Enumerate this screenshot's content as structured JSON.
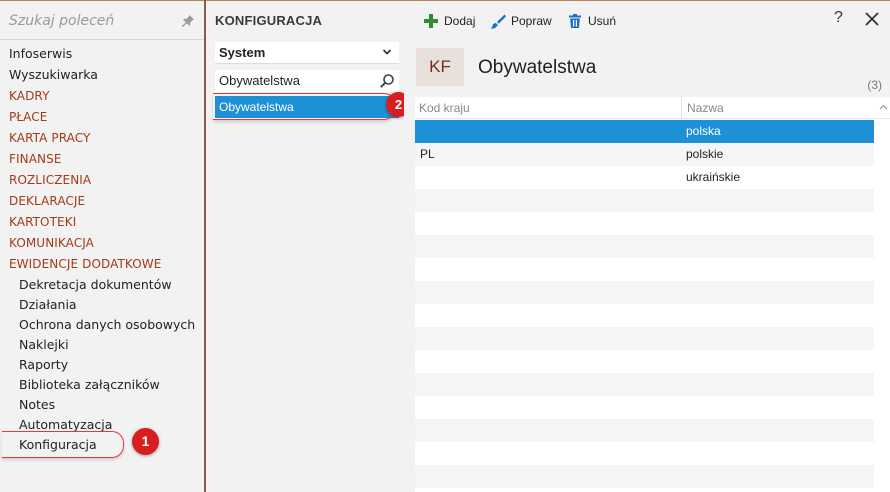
{
  "nav": {
    "search_placeholder": "Szukaj poleceń",
    "items": [
      {
        "label": "Infoserwis",
        "kind": "plain"
      },
      {
        "label": "Wyszukiwarka",
        "kind": "plain"
      },
      {
        "label": "KADRY",
        "kind": "cat"
      },
      {
        "label": "PŁACE",
        "kind": "cat"
      },
      {
        "label": "KARTA PRACY",
        "kind": "cat"
      },
      {
        "label": "FINANSE",
        "kind": "cat"
      },
      {
        "label": "ROZLICZENIA",
        "kind": "cat"
      },
      {
        "label": "DEKLARACJE",
        "kind": "cat"
      },
      {
        "label": "KARTOTEKI",
        "kind": "cat"
      },
      {
        "label": "KOMUNIKACJA",
        "kind": "cat"
      },
      {
        "label": "EWIDENCJE DODATKOWE",
        "kind": "cat"
      },
      {
        "label": "Dekretacja dokumentów",
        "kind": "sub"
      },
      {
        "label": "Działania",
        "kind": "sub"
      },
      {
        "label": "Ochrona danych osobowych",
        "kind": "sub"
      },
      {
        "label": "Naklejki",
        "kind": "sub"
      },
      {
        "label": "Raporty",
        "kind": "sub"
      },
      {
        "label": "Biblioteka załączników",
        "kind": "sub"
      },
      {
        "label": "Notes",
        "kind": "sub"
      },
      {
        "label": "Automatyzacja",
        "kind": "sub"
      },
      {
        "label": "Konfiguracja",
        "kind": "sub"
      }
    ],
    "badge_1": "1"
  },
  "middle": {
    "title": "KONFIGURACJA",
    "select_value": "System",
    "filter_value": "Obywatelstwa",
    "item": "Obywatelstwa",
    "badge_2": "2"
  },
  "toolbar": {
    "add_label": "Dodaj",
    "edit_label": "Popraw",
    "delete_label": "Usuń",
    "help_label": "?"
  },
  "main": {
    "badge": "KF",
    "title": "Obywatelstwa",
    "count": "(3)",
    "columns": [
      "Kod kraju",
      "Nazwa"
    ],
    "rows": [
      {
        "code": "",
        "name": "polska"
      },
      {
        "code": "PL",
        "name": "polskie"
      },
      {
        "code": "",
        "name": "ukraińskie"
      }
    ]
  },
  "colors": {
    "accent_red": "#a33a18",
    "selection_blue": "#1e90d6",
    "badge_red": "#d81e1e"
  }
}
